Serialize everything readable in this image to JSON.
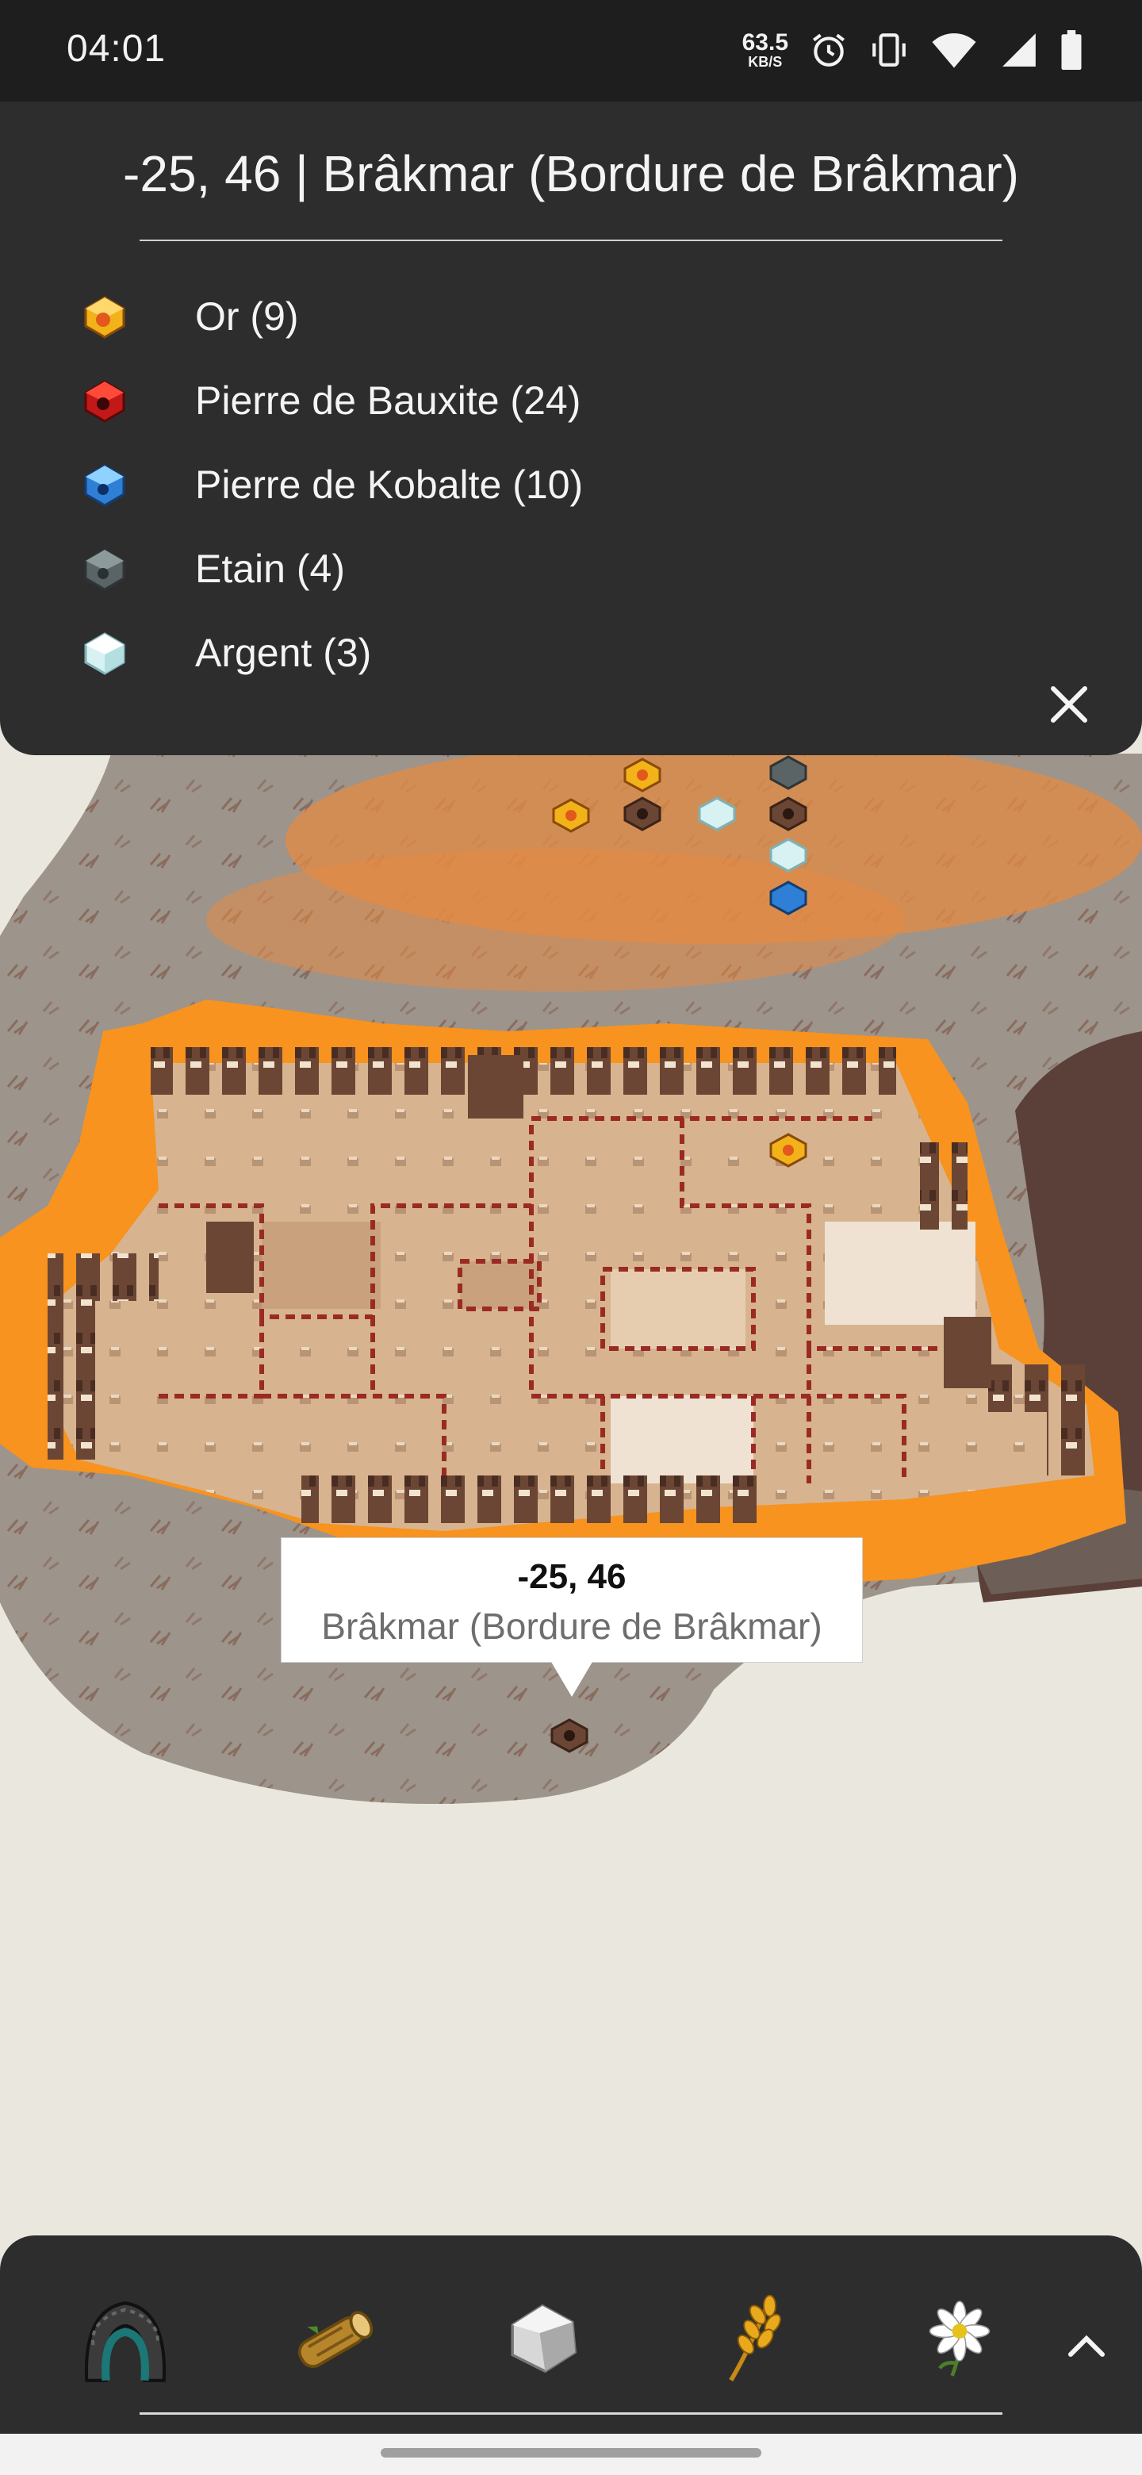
{
  "status_bar": {
    "time": "04:01",
    "net_speed_value": "63.5",
    "net_speed_unit": "KB/S",
    "icons": [
      "alarm-icon",
      "vibrate-icon",
      "wifi-icon",
      "signal-icon",
      "battery-icon"
    ]
  },
  "panel": {
    "title": "-25, 46 | Brâkmar (Bordure de Brâkmar)",
    "resources": [
      {
        "icon": "gold-ore-icon",
        "label": "Or (9)"
      },
      {
        "icon": "bauxite-ore-icon",
        "label": "Pierre de Bauxite (24)"
      },
      {
        "icon": "cobalt-ore-icon",
        "label": "Pierre de Kobalte (10)"
      },
      {
        "icon": "tin-ore-icon",
        "label": "Etain (4)"
      },
      {
        "icon": "silver-ore-icon",
        "label": "Argent (3)"
      }
    ],
    "close_icon": "close-icon"
  },
  "map": {
    "tooltip": {
      "coords": "-25, 46",
      "region": "Brâkmar (Bordure de Brâkmar)"
    }
  },
  "bottom_bar": {
    "tools": [
      {
        "name": "hunter-icon"
      },
      {
        "name": "lumberjack-icon"
      },
      {
        "name": "miner-icon"
      },
      {
        "name": "farmer-icon"
      },
      {
        "name": "alchemist-icon"
      }
    ],
    "expand_icon": "chevron-up-icon"
  },
  "colors": {
    "panel_bg": "#2d2d2d",
    "status_bg": "#1e1e1e",
    "map_bg": "#eae7df",
    "lava_orange": "#f7931e",
    "city_sand": "#d7b48f",
    "wall_dark": "#6b4634",
    "border_red": "#9a2a24"
  }
}
